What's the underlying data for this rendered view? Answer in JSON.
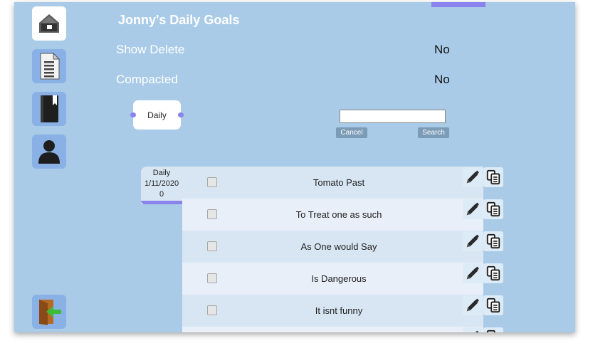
{
  "nav": {
    "items": [
      {
        "id": "home",
        "icon": "home-icon"
      },
      {
        "id": "notes",
        "icon": "document-icon"
      },
      {
        "id": "journal",
        "icon": "book-icon"
      },
      {
        "id": "profile",
        "icon": "person-icon"
      }
    ],
    "logout_icon": "exit-door-icon"
  },
  "header": {
    "title": "Jonny's Daily Goals"
  },
  "options": [
    {
      "label": "Show Delete",
      "value": "No"
    },
    {
      "label": "Compacted",
      "value": "No"
    }
  ],
  "filter": {
    "label": "Daily"
  },
  "search": {
    "placeholder": "",
    "value": "",
    "cancel_label": "Cancel",
    "search_label": "Search"
  },
  "group": {
    "line1": "Daily",
    "line2": "1/11/2020",
    "line3": "0"
  },
  "goals": [
    {
      "label": "Tomato Past",
      "checked": false
    },
    {
      "label": "To Treat one as such",
      "checked": false
    },
    {
      "label": "As One would Say",
      "checked": false
    },
    {
      "label": "Is Dangerous",
      "checked": false
    },
    {
      "label": "It isnt funny",
      "checked": false
    }
  ],
  "colors": {
    "background": "#a9cbe8",
    "accent": "#8a83ec",
    "nav_button": "#8ab1e6",
    "row_light": "#e8eff8",
    "row_dark": "#d8e6f3"
  }
}
